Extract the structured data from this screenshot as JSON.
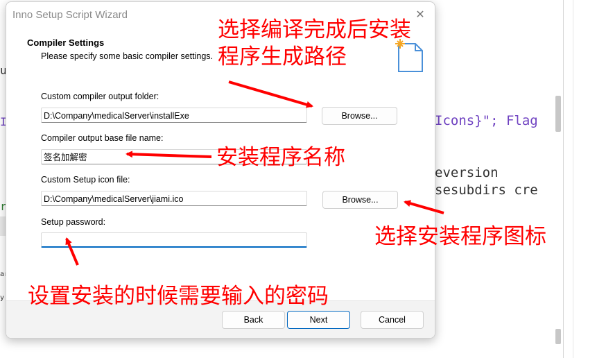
{
  "dialog": {
    "title": "Inno Setup Script Wizard",
    "close_symbol": "✕",
    "section_title": "Compiler Settings",
    "section_subtitle": "Please specify some basic compiler settings.",
    "output_folder": {
      "label": "Custom compiler output folder:",
      "value": "D:\\Company\\medicalServer\\installExe",
      "browse_label": "Browse..."
    },
    "base_file_name": {
      "label": "Compiler output base file name:",
      "value": "签名加解密"
    },
    "setup_icon": {
      "label": "Custom Setup icon file:",
      "value": "D:\\Company\\medicalServer\\jiami.ico",
      "browse_label": "Browse..."
    },
    "setup_password": {
      "label": "Setup password:",
      "value": ""
    },
    "buttons": {
      "back": "Back",
      "next": "Next",
      "cancel": "Cancel"
    }
  },
  "background_editor": {
    "line1": "Icons}\"; Flag",
    "line2": "eversion",
    "line3": "sesubdirs cre",
    "left_fragments": [
      "u",
      "I",
      "r",
      "ar",
      "y.",
      "#"
    ]
  },
  "annotations": {
    "output_path": "选择编译完成后安装\n程序生成路径",
    "output_path_line1": "选择编译完成后安装",
    "output_path_line2": "程序生成路径",
    "program_name": "安装程序名称",
    "program_icon": "选择安装程序图标",
    "password": "设置安装的时候需要输入的密码"
  },
  "colors": {
    "annotation": "#ff0000",
    "accent": "#0067c0",
    "editor_keyword": "#6f42c1"
  },
  "icons": [
    "close-icon",
    "wizard-document-icon"
  ]
}
